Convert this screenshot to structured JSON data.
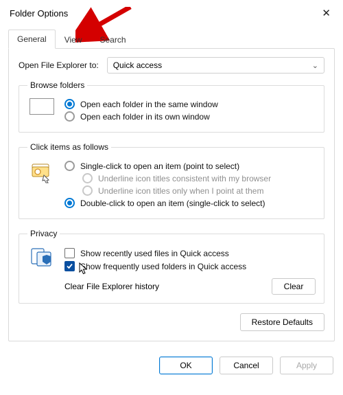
{
  "window": {
    "title": "Folder Options"
  },
  "tabs": {
    "general": "General",
    "view": "View",
    "search": "Search"
  },
  "open_explorer": {
    "label": "Open File Explorer to:",
    "value": "Quick access"
  },
  "browse": {
    "legend": "Browse folders",
    "same_window": "Open each folder in the same window",
    "own_window": "Open each folder in its own window"
  },
  "click": {
    "legend": "Click items as follows",
    "single": "Single-click to open an item (point to select)",
    "underline_browser": "Underline icon titles consistent with my browser",
    "underline_point": "Underline icon titles only when I point at them",
    "double": "Double-click to open an item (single-click to select)"
  },
  "privacy": {
    "legend": "Privacy",
    "recent_files": "Show recently used files in Quick access",
    "frequent_folders": "Show frequently used folders in Quick access",
    "clear_label": "Clear File Explorer history",
    "clear_btn": "Clear"
  },
  "restore": "Restore Defaults",
  "footer": {
    "ok": "OK",
    "cancel": "Cancel",
    "apply": "Apply"
  }
}
